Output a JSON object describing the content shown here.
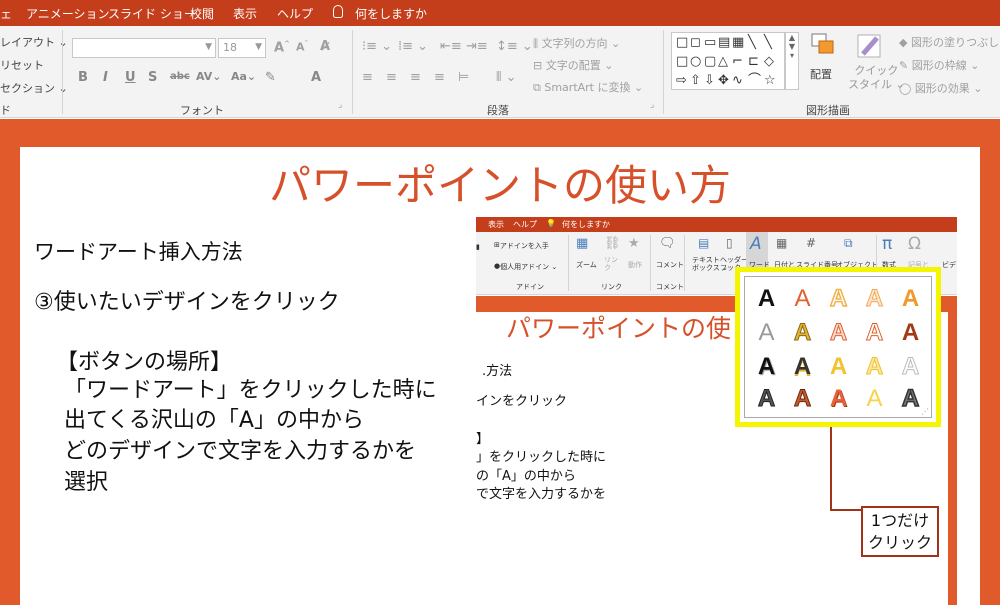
{
  "tabs": [
    "ェ",
    "アニメーション",
    "スライド ショー",
    "校閲",
    "表示",
    "ヘルプ"
  ],
  "tell_me": "何をしますか",
  "ribbon": {
    "slides_items": [
      "レイアウト ⌄",
      "リセット",
      "セクション ⌄"
    ],
    "slides_label": "ド",
    "font_name": "",
    "font_size": "18",
    "font_label": "フォント",
    "paragraph": {
      "text_direction": "文字列の方向 ⌄",
      "align_text": "文字の配置 ⌄",
      "smartart": "SmartArt に変換 ⌄",
      "label": "段落"
    },
    "drawing": {
      "arrange": "配置",
      "quick_styles": "クイック\nスタイル ⌄",
      "shape_fill": "図形の塗りつぶし ⌄",
      "shape_outline": "図形の枠線 ⌄",
      "shape_effects": "図形の効果 ⌄",
      "label": "図形描画"
    }
  },
  "slide": {
    "title": "パワーポイントの使い方",
    "line1": "ワードアート挿入方法",
    "line2": "③使いたいデザインをクリック",
    "line3": "【ボタンの場所】",
    "line4": "「ワードアート」をクリックした時に",
    "line5": "出てくる沢山の「A」の中から",
    "line6": "どのデザインで文字を入力するかを",
    "line7": "選択"
  },
  "inset": {
    "tabs": [
      "表示",
      "ヘルプ",
      "何をしますか"
    ],
    "ribbon": {
      "get_addins": "アドインを入手",
      "my_addins": "個人用アドイン ⌄",
      "addins_label": "アドイン",
      "zoom": "ズーム",
      "link": "リン\nク",
      "action": "動作",
      "link_label": "リンク",
      "comment": "コメント",
      "comment_label": "コメント",
      "textbox": "テキスト\nボックス ⌄",
      "header": "ヘッダーと\nフッター",
      "wordart": "ワード",
      "date": "日付と",
      "slide_number": "スライド番号",
      "object": "オブジェクト",
      "equation": "数式",
      "symbol": "記号と",
      "video": "ビデ"
    },
    "title": "パワーポイントの使",
    "line1": ".方法",
    "line2": "インをクリック",
    "line3": "】",
    "line4": "」をクリックした時に",
    "line5": "の「A」の中から",
    "line6": "で文字を入力するかを"
  },
  "wordart_glyph": "A",
  "callout": {
    "line1": "1つだけ",
    "line2": "クリック"
  },
  "colors": {
    "tab_red": "#c43e1c",
    "slide_orange": "#e05a2b",
    "title_orange": "#d6502a",
    "highlight_yellow": "#f5f500",
    "callout_border": "#a0341a"
  }
}
